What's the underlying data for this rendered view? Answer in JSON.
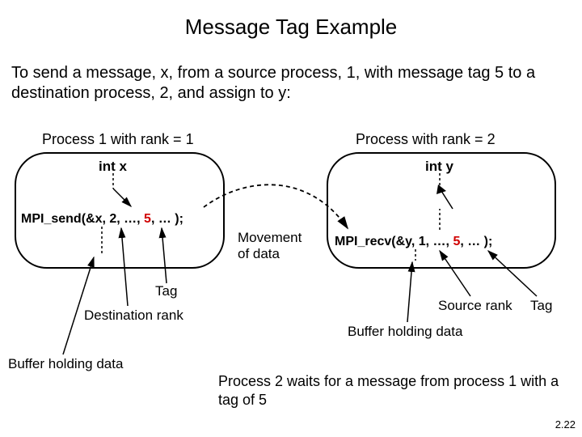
{
  "title": "Message Tag Example",
  "description": "To send a message, x, from a source process, 1, with message tag 5 to a destination process, 2, and assign to y:",
  "left": {
    "label": "Process 1 with rank = 1",
    "var": "int x",
    "call_prefix": "MPI_send(&x, 2, …, ",
    "call_tag": "5",
    "call_suffix": ", … );"
  },
  "right": {
    "label": "Process with rank = 2",
    "var": "int y",
    "call_prefix": "MPI_recv(&y, 1, …, ",
    "call_tag": "5",
    "call_suffix": ", … );"
  },
  "movement": "Movement\nof data",
  "annotations": {
    "tag_left": "Tag",
    "dest_rank": "Destination rank",
    "buffer_left": "Buffer holding data",
    "source_rank": "Source rank",
    "tag_right": "Tag",
    "buffer_right": "Buffer holding data"
  },
  "note": "Process 2 waits for a message from process 1 with a tag of 5",
  "page": "2.22"
}
